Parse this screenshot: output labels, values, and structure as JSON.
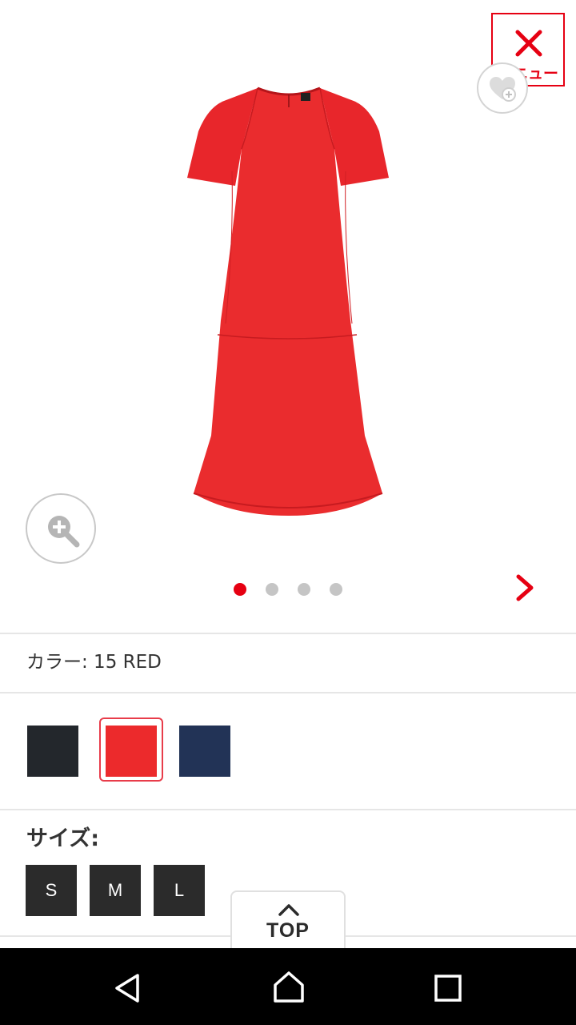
{
  "header": {
    "menu_label": "メニュー",
    "menu_icon": "close-x-icon",
    "favorite_icon": "heart-plus-icon"
  },
  "gallery": {
    "product_image": "red short-sleeve dress",
    "zoom_icon": "zoom-in-icon",
    "total_images": 4,
    "active_index": 0,
    "next_icon": "chevron-right-icon"
  },
  "color": {
    "label": "カラー: 15 RED",
    "swatches": [
      {
        "name": "black",
        "hex": "#23272c",
        "selected": false
      },
      {
        "name": "red",
        "hex": "#ec2a2c",
        "selected": true
      },
      {
        "name": "navy",
        "hex": "#223356",
        "selected": false
      }
    ]
  },
  "size": {
    "title": "サイズ:",
    "options": [
      "S",
      "M",
      "L"
    ]
  },
  "top_button": {
    "label": "TOP",
    "icon": "chevron-up-icon"
  },
  "system_nav": {
    "icons": [
      "back-icon",
      "home-icon",
      "recents-icon"
    ]
  },
  "colors": {
    "accent": "#e60012",
    "dark": "#2b2b2b"
  }
}
